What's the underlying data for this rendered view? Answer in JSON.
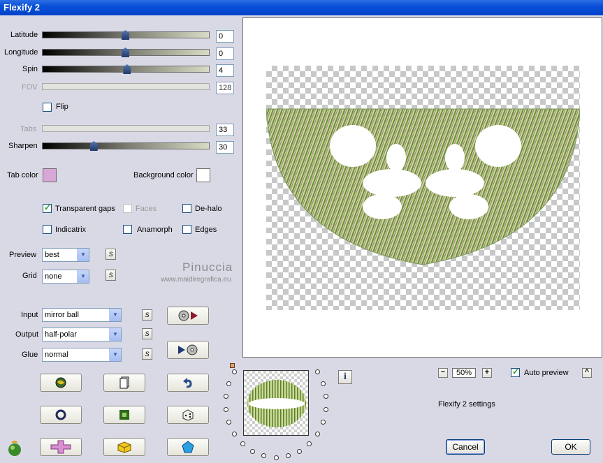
{
  "window": {
    "title": "Flexify 2"
  },
  "sliders": [
    {
      "label": "Latitude",
      "value": "0",
      "position": 0.5,
      "enabled": true
    },
    {
      "label": "Longitude",
      "value": "0",
      "position": 0.5,
      "enabled": true
    },
    {
      "label": "Spin",
      "value": "4",
      "position": 0.51,
      "enabled": true
    },
    {
      "label": "FOV",
      "value": "128",
      "enabled": false
    },
    {
      "label": "Tabs",
      "value": "33",
      "enabled": false
    },
    {
      "label": "Sharpen",
      "value": "30",
      "position": 0.31,
      "enabled": true
    }
  ],
  "flip": {
    "label": "Flip",
    "checked": false
  },
  "colors": {
    "tab_color_label": "Tab color",
    "tab_color": "#d9a6d8",
    "background_color_label": "Background color",
    "background_color": "#ffffff"
  },
  "options": {
    "transparent_gaps": {
      "label": "Transparent gaps",
      "checked": true
    },
    "faces": {
      "label": "Faces",
      "checked": false,
      "enabled": false
    },
    "de_halo": {
      "label": "De-halo",
      "checked": false
    },
    "indicatrix": {
      "label": "Indicatrix",
      "checked": false
    },
    "anamorph": {
      "label": "Anamorph",
      "checked": false
    },
    "edges": {
      "label": "Edges",
      "checked": false
    }
  },
  "preview_quality": {
    "label": "Preview",
    "value": "best"
  },
  "grid": {
    "label": "Grid",
    "value": "none"
  },
  "input": {
    "label": "Input",
    "value": "mirror ball"
  },
  "output": {
    "label": "Output",
    "value": "half-polar"
  },
  "glue": {
    "label": "Glue",
    "value": "normal"
  },
  "s_button_label": "S",
  "watermark": {
    "line1": "Pinuccia",
    "line2": "www.maidiregrafica.eu"
  },
  "zoom": {
    "value": "50%",
    "minus": "−",
    "plus": "+"
  },
  "auto_preview": {
    "label": "Auto preview",
    "checked": true
  },
  "collapse_label": "^",
  "info_label": "i",
  "settings_text": "Flexify 2 settings",
  "buttons": {
    "cancel": "Cancel",
    "ok": "OK"
  },
  "palette": {
    "accent_title": "#0a4fd8",
    "thumb_dark": "#1f3a72"
  }
}
